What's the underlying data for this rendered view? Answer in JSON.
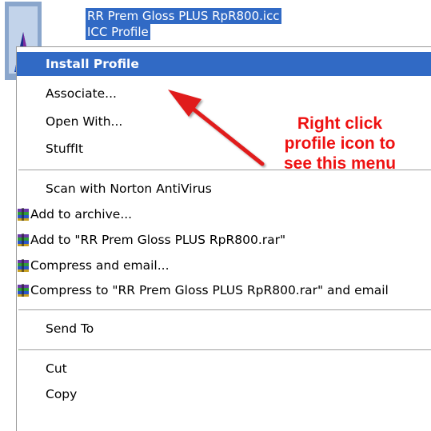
{
  "file": {
    "name": "RR Prem Gloss PLUS RpR800.icc",
    "type": "ICC Profile"
  },
  "menu": {
    "items": [
      {
        "label": "Install Profile",
        "default": true
      },
      {
        "label": "Associate..."
      },
      {
        "label": "Open With..."
      },
      {
        "label": "StuffIt"
      },
      {
        "label": "Scan with Norton AntiVirus"
      },
      {
        "label": "Add to archive...",
        "icon": "winrar-icon"
      },
      {
        "label": "Add to \"RR Prem Gloss PLUS RpR800.rar\"",
        "icon": "winrar-icon"
      },
      {
        "label": "Compress and email...",
        "icon": "winrar-icon"
      },
      {
        "label": "Compress to \"RR Prem Gloss PLUS RpR800.rar\" and email",
        "icon": "winrar-icon"
      },
      {
        "label": "Send To"
      },
      {
        "label": "Cut"
      },
      {
        "label": "Copy"
      }
    ]
  },
  "annotation": {
    "lines": [
      "Right click",
      "profile icon to",
      "see this menu"
    ],
    "color": "#ee1111"
  },
  "colors": {
    "selection": "#316ac5",
    "arrow": "#e01a1a"
  }
}
